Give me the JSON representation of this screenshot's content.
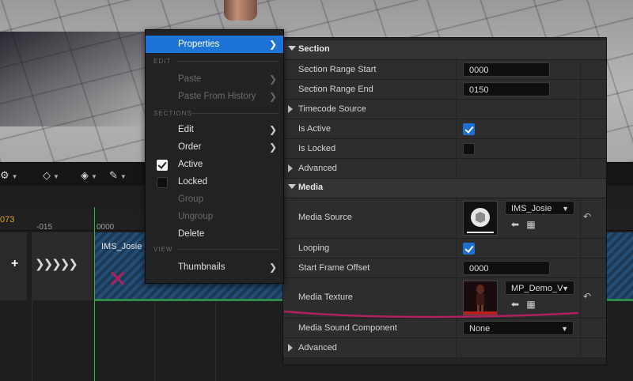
{
  "timeline": {
    "frame_number": "073",
    "ticks": [
      "-015",
      "0000"
    ],
    "section_name": "IMS_Josie"
  },
  "context_menu": {
    "properties": "Properties",
    "edit_header": "EDIT",
    "paste": "Paste",
    "paste_from_history": "Paste From History",
    "sections_header": "SECTIONS",
    "edit": "Edit",
    "order": "Order",
    "active": "Active",
    "locked": "Locked",
    "group": "Group",
    "ungroup": "Ungroup",
    "delete": "Delete",
    "view_header": "VIEW",
    "thumbnails": "Thumbnails"
  },
  "details": {
    "section_header": "Section",
    "section_range_start_label": "Section Range Start",
    "section_range_start_value": "0000",
    "section_range_end_label": "Section Range End",
    "section_range_end_value": "0150",
    "timecode_source_label": "Timecode Source",
    "is_active_label": "Is Active",
    "is_active": true,
    "is_locked_label": "Is Locked",
    "is_locked": false,
    "advanced_label": "Advanced",
    "media_header": "Media",
    "media_source_label": "Media Source",
    "media_source_value": "IMS_Josie",
    "looping_label": "Looping",
    "looping": true,
    "start_frame_offset_label": "Start Frame Offset",
    "start_frame_offset_value": "0000",
    "media_texture_label": "Media Texture",
    "media_texture_value": "MP_Demo_V",
    "media_sound_component_label": "Media Sound Component",
    "media_sound_component_value": "None",
    "advanced_label_2": "Advanced"
  },
  "colors": {
    "menu_highlight": "#1e74d6",
    "checkbox_on": "#1f6fd0",
    "playhead": "#2fb84a",
    "annotation": "#b0205e",
    "frame_number": "#e0a020"
  }
}
